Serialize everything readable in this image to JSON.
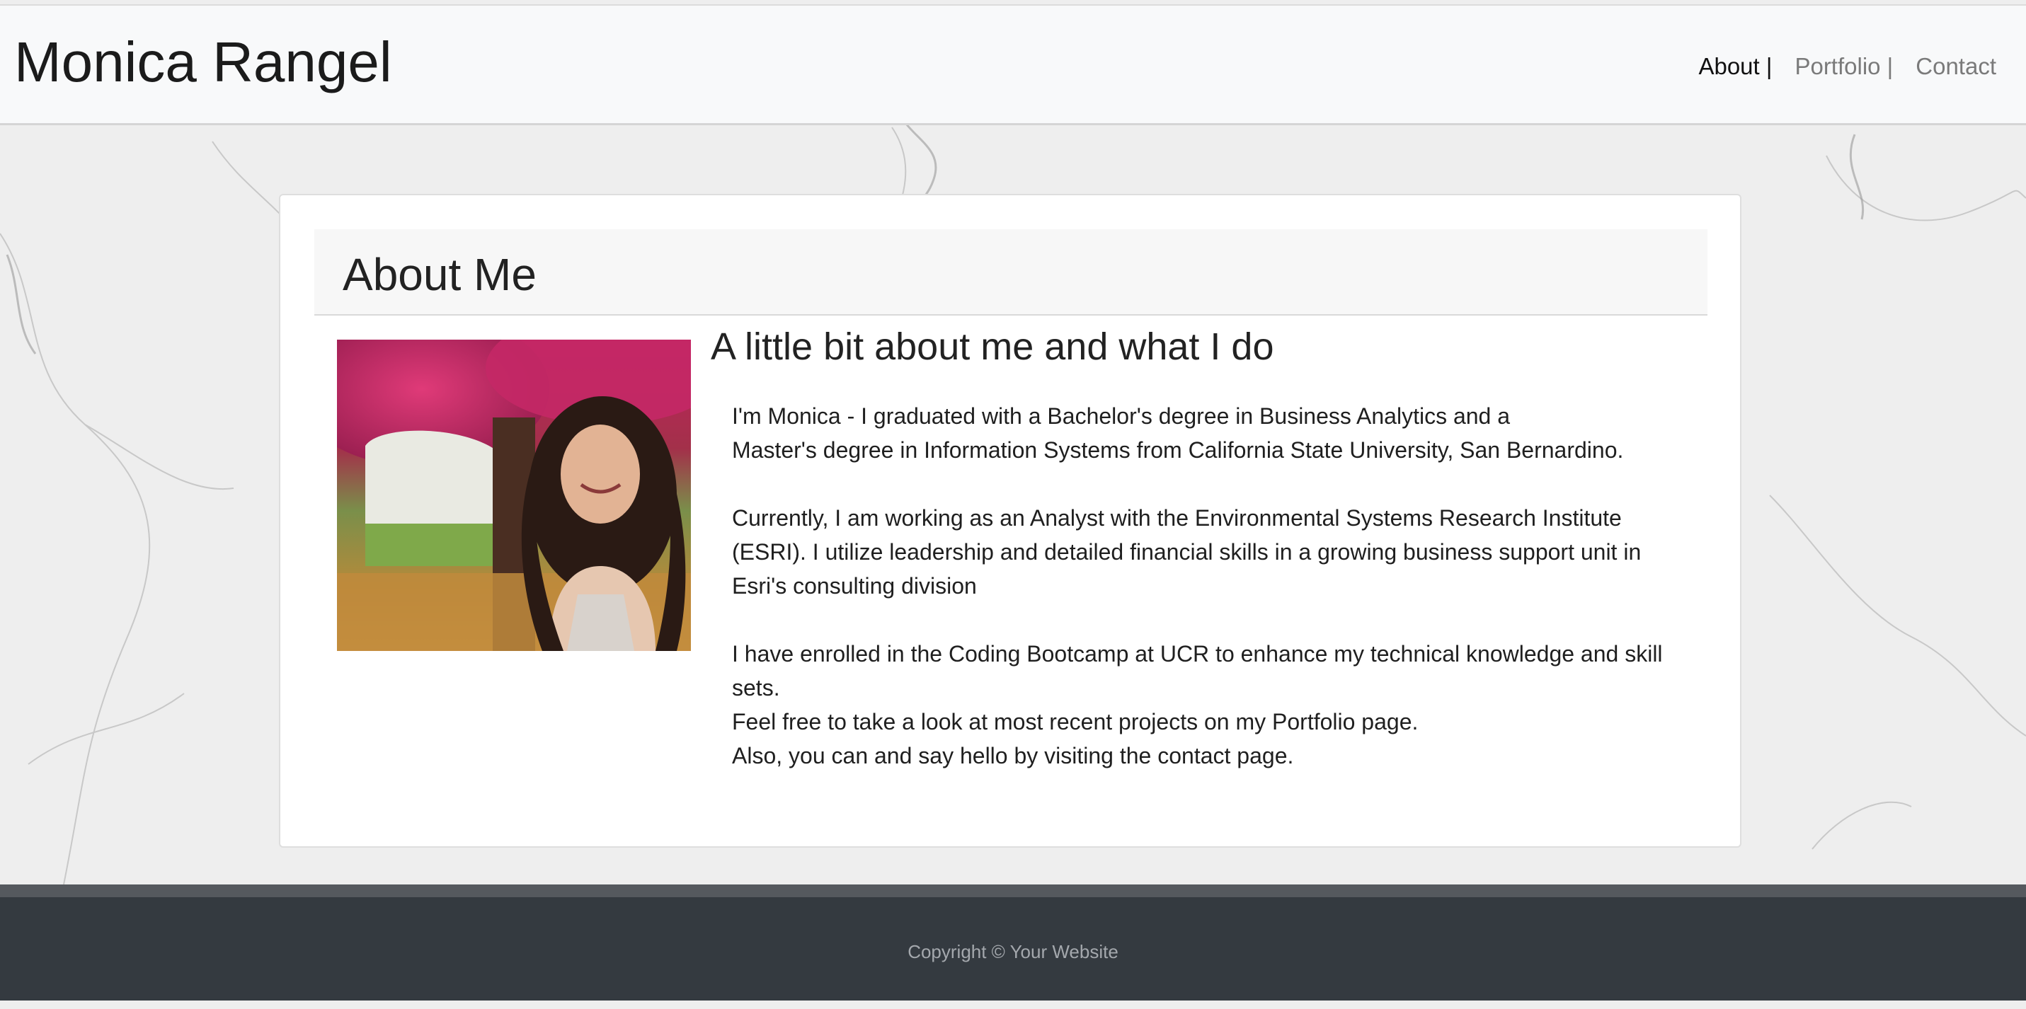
{
  "header": {
    "brand": "Monica Rangel",
    "nav": [
      {
        "label": "About |",
        "active": true
      },
      {
        "label": "Portfolio |",
        "active": false
      },
      {
        "label": "Contact",
        "active": false
      }
    ]
  },
  "card": {
    "title": "About Me",
    "subtitle": "A little bit about me and what I do",
    "paragraphs": [
      "I'm Monica - I graduated with a Bachelor's degree in Business Analytics and a\nMaster's degree in Information Systems from California State University, San Bernardino.",
      "Currently, I am working as an Analyst with the Environmental Systems Research Institute (ESRI). I utilize leadership and detailed financial skills in a growing business support unit in Esri's consulting division",
      "I have enrolled in the Coding Bootcamp at UCR to enhance my technical knowledge and skill sets.\nFeel free to take a look at most recent projects on my Portfolio page.\nAlso, you can and say hello by visiting the contact page."
    ]
  },
  "footer": {
    "copyright": "Copyright © Your Website"
  },
  "colors": {
    "navbar_bg": "#f8f9fa",
    "footer_bg": "#343a40",
    "footer_text": "#a4a8ad",
    "nav_active": "#111111",
    "nav_inactive": "#7a7a7a"
  }
}
